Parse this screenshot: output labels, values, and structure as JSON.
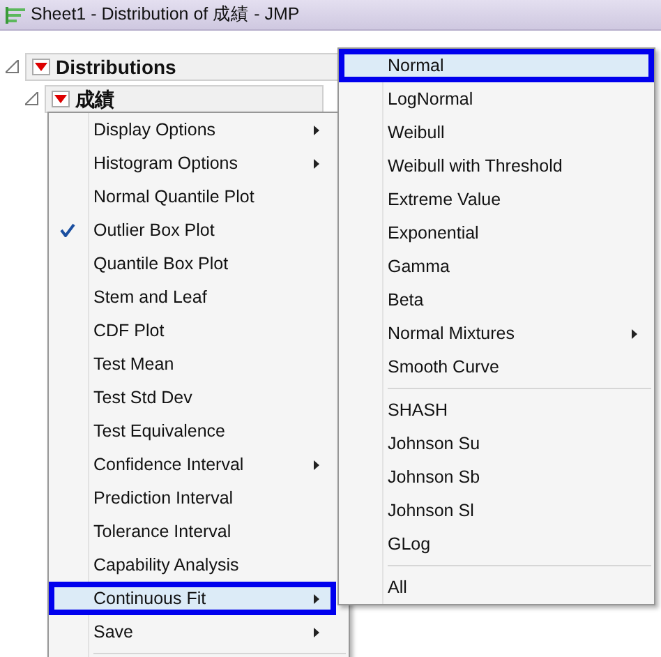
{
  "window": {
    "title": "Sheet1 - Distribution of 成績 - JMP"
  },
  "outline": [
    {
      "title": "Distributions",
      "expanded": true
    },
    {
      "title": "成績",
      "expanded": true
    }
  ],
  "menu": [
    {
      "label": "Display Options",
      "kind": "submenu",
      "checked": false,
      "selected": false
    },
    {
      "label": "Histogram Options",
      "kind": "submenu",
      "checked": false,
      "selected": false
    },
    {
      "label": "Normal Quantile Plot",
      "kind": "item",
      "checked": false,
      "selected": false
    },
    {
      "label": "Outlier Box Plot",
      "kind": "item",
      "checked": true,
      "selected": false
    },
    {
      "label": "Quantile Box Plot",
      "kind": "item",
      "checked": false,
      "selected": false
    },
    {
      "label": "Stem and Leaf",
      "kind": "item",
      "checked": false,
      "selected": false
    },
    {
      "label": "CDF Plot",
      "kind": "item",
      "checked": false,
      "selected": false
    },
    {
      "label": "Test Mean",
      "kind": "item",
      "checked": false,
      "selected": false
    },
    {
      "label": "Test Std Dev",
      "kind": "item",
      "checked": false,
      "selected": false
    },
    {
      "label": "Test Equivalence",
      "kind": "item",
      "checked": false,
      "selected": false
    },
    {
      "label": "Confidence Interval",
      "kind": "submenu",
      "checked": false,
      "selected": false
    },
    {
      "label": "Prediction Interval",
      "kind": "item",
      "checked": false,
      "selected": false
    },
    {
      "label": "Tolerance Interval",
      "kind": "item",
      "checked": false,
      "selected": false
    },
    {
      "label": "Capability Analysis",
      "kind": "item",
      "checked": false,
      "selected": false
    },
    {
      "label": "Continuous Fit",
      "kind": "submenu",
      "checked": false,
      "selected": true
    },
    {
      "label": "Save",
      "kind": "submenu",
      "checked": false,
      "selected": false
    },
    {
      "kind": "separator"
    }
  ],
  "submenu": [
    {
      "label": "Normal",
      "kind": "item",
      "selected": true
    },
    {
      "label": "LogNormal",
      "kind": "item",
      "selected": false
    },
    {
      "label": "Weibull",
      "kind": "item",
      "selected": false
    },
    {
      "label": "Weibull with Threshold",
      "kind": "item",
      "selected": false
    },
    {
      "label": "Extreme Value",
      "kind": "item",
      "selected": false
    },
    {
      "label": "Exponential",
      "kind": "item",
      "selected": false
    },
    {
      "label": "Gamma",
      "kind": "item",
      "selected": false
    },
    {
      "label": "Beta",
      "kind": "item",
      "selected": false
    },
    {
      "label": "Normal Mixtures",
      "kind": "submenu",
      "selected": false
    },
    {
      "label": "Smooth Curve",
      "kind": "item",
      "selected": false
    },
    {
      "kind": "separator"
    },
    {
      "label": "SHASH",
      "kind": "item",
      "selected": false
    },
    {
      "label": "Johnson Su",
      "kind": "item",
      "selected": false
    },
    {
      "label": "Johnson Sb",
      "kind": "item",
      "selected": false
    },
    {
      "label": "Johnson Sl",
      "kind": "item",
      "selected": false
    },
    {
      "label": "GLog",
      "kind": "item",
      "selected": false
    },
    {
      "kind": "separator"
    },
    {
      "label": "All",
      "kind": "item",
      "selected": false
    }
  ]
}
